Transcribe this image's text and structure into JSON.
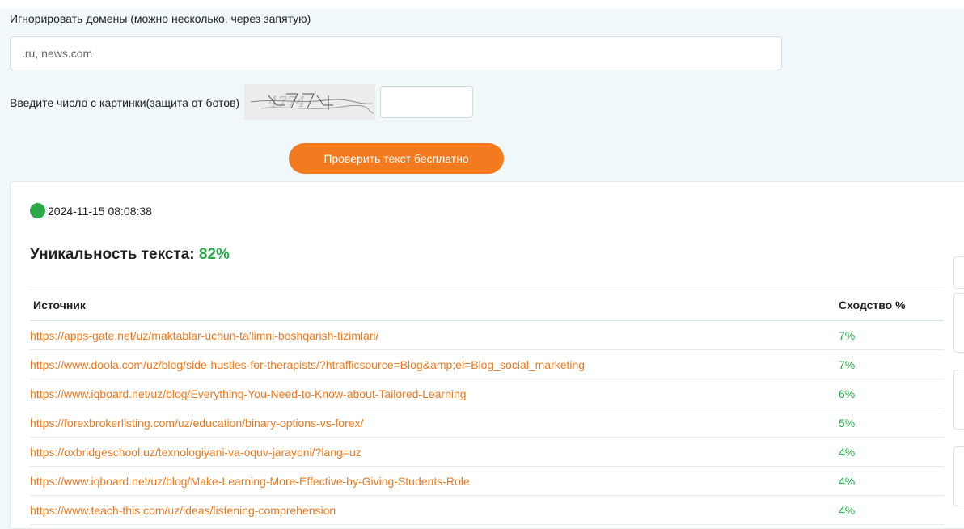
{
  "form": {
    "ignore_label": "Игнорировать домены (можно несколько, через запятую)",
    "ignore_placeholder": ".ru, news.com",
    "captcha_label": "Введите число с картинки(защита от ботов)",
    "captcha_image_text": "4774",
    "captcha_value": "",
    "submit_label": "Проверить текст бесплатно"
  },
  "result": {
    "status_color": "#2aa84a",
    "timestamp": "2024-11-15 08:08:38",
    "uniqueness_label": "Уникальность текста:",
    "uniqueness_value": "82%",
    "table": {
      "headers": [
        "Источник",
        "Сходство %"
      ],
      "rows": [
        {
          "url": "https://apps-gate.net/uz/maktablar-uchun-ta'limni-boshqarish-tizimlari/",
          "similarity": "7%"
        },
        {
          "url": "https://www.doola.com/uz/blog/side-hustles-for-therapists/?htrafficsource=Blog&amp;el=Blog_social_marketing",
          "similarity": "7%"
        },
        {
          "url": "https://www.iqboard.net/uz/blog/Everything-You-Need-to-Know-about-Tailored-Learning",
          "similarity": "6%"
        },
        {
          "url": "https://forexbrokerlisting.com/uz/education/binary-options-vs-forex/",
          "similarity": "5%"
        },
        {
          "url": "https://oxbridgeschool.uz/texnologiyani-va-oquv-jarayoni/?lang=uz",
          "similarity": "4%"
        },
        {
          "url": "https://www.iqboard.net/uz/blog/Make-Learning-More-Effective-by-Giving-Students-Role",
          "similarity": "4%"
        },
        {
          "url": "https://www.teach-this.com/uz/ideas/listening-comprehension",
          "similarity": "4%"
        }
      ]
    }
  },
  "colors": {
    "accent": "#f47a1f",
    "link": "#ec7a1e",
    "success": "#2aa84a",
    "page_background": "#f1f8fa"
  }
}
